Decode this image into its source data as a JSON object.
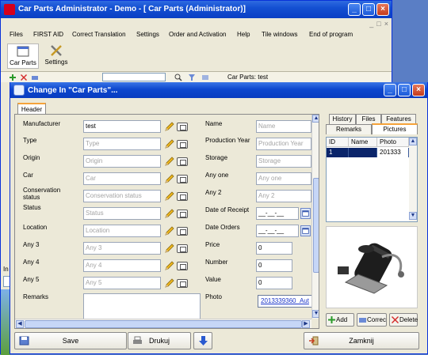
{
  "main_window": {
    "title": "Car Parts  Administrator - Demo - [       Car Parts (Administrator)]",
    "menu": [
      "Files",
      "FIRST AID",
      "Correct Translation",
      "Settings",
      "Order and Activation",
      "Help",
      "Tile windows",
      "End of program"
    ],
    "toolbar": {
      "car_parts_label": "Car Parts",
      "settings_label": "Settings"
    },
    "subtoolbar_label": "Car Parts: test",
    "info_label": "In"
  },
  "dialog": {
    "title": "Change  In \"Car Parts\"...",
    "header_tab": "Header",
    "left_fields": [
      {
        "label": "Manufacturer",
        "value": "test",
        "placeholder": ""
      },
      {
        "label": "Type",
        "value": "",
        "placeholder": "Type"
      },
      {
        "label": "Origin",
        "value": "",
        "placeholder": "Origin"
      },
      {
        "label": "Car",
        "value": "",
        "placeholder": "Car"
      },
      {
        "label": "Conservation status",
        "value": "",
        "placeholder": "Conservation status"
      },
      {
        "label": "Status",
        "value": "",
        "placeholder": "Status"
      },
      {
        "label": "Location",
        "value": "",
        "placeholder": "Location"
      },
      {
        "label": "Any 3",
        "value": "",
        "placeholder": "Any 3"
      },
      {
        "label": "Any 4",
        "value": "",
        "placeholder": "Any 4"
      },
      {
        "label": "Any 5",
        "value": "",
        "placeholder": "Any 5"
      }
    ],
    "remarks_label": "Remarks",
    "right_fields": [
      {
        "label": "Name",
        "value": "",
        "placeholder": "Name"
      },
      {
        "label": "Production Year",
        "value": "",
        "placeholder": "Production Year"
      },
      {
        "label": "Storage",
        "value": "",
        "placeholder": "Storage"
      },
      {
        "label": "Any one",
        "value": "",
        "placeholder": "Any one"
      },
      {
        "label": "Any 2",
        "value": "",
        "placeholder": "Any 2"
      },
      {
        "label": "Date of Receipt",
        "value": "__-__-__",
        "placeholder": ""
      },
      {
        "label": "Date Orders",
        "value": "__-__-__",
        "placeholder": ""
      },
      {
        "label": "Price",
        "value": "0",
        "placeholder": ""
      },
      {
        "label": "Number",
        "value": "0",
        "placeholder": ""
      },
      {
        "label": "Value",
        "value": "0",
        "placeholder": ""
      }
    ],
    "photo_label": "Photo",
    "photo_link": "2013339360_Aut",
    "side_tabs_row1": [
      "History",
      "Files",
      "Features"
    ],
    "side_tabs_row2": [
      "Remarks",
      "Pictures"
    ],
    "grid": {
      "columns": [
        "ID",
        "Name",
        "Photo"
      ],
      "rows": [
        [
          "1",
          "",
          "201333"
        ]
      ]
    },
    "picture_buttons": {
      "add": "Add",
      "correct": "Correc",
      "delete": "Delete"
    },
    "bottom_buttons": {
      "save": "Save",
      "print": "Drukuj",
      "close": "Zamknij"
    }
  }
}
